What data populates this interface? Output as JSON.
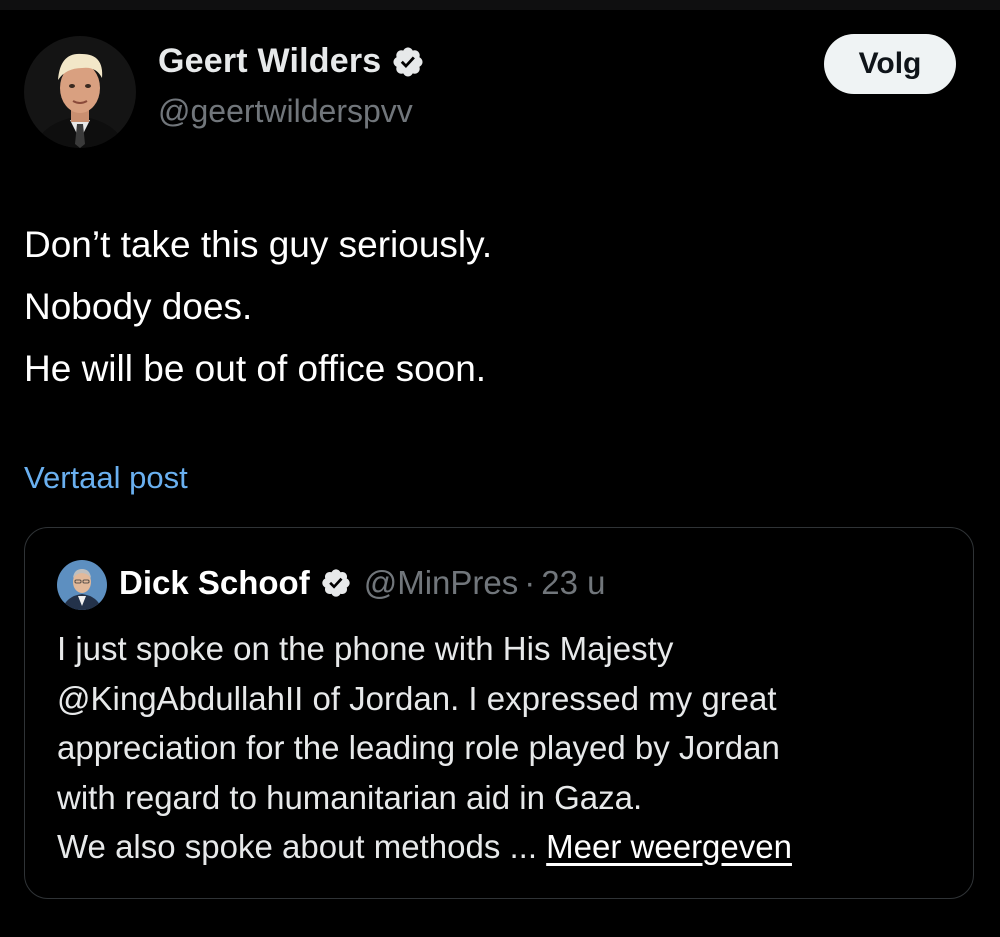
{
  "post": {
    "author": {
      "name": "Geert Wilders",
      "handle": "@geertwilderspvv",
      "verified_icon": "verified-badge-icon"
    },
    "follow_label": "Volg",
    "text_lines": [
      "Don’t take this guy seriously.",
      "Nobody does.",
      "He will be out of office soon."
    ],
    "translate_label": "Vertaal post"
  },
  "quoted_post": {
    "author": {
      "name": "Dick Schoof",
      "handle": "@MinPres",
      "verified_icon": "verified-badge-icon"
    },
    "separator": "·",
    "time": "23 u",
    "text_lines": [
      "I just spoke on the phone with His Majesty",
      "@KingAbdullahII of Jordan. I expressed my great",
      "appreciation for the leading role played by Jordan",
      "with regard to humanitarian aid in Gaza."
    ],
    "last_line": "We also spoke about methods ...",
    "show_more_label": "Meer weergeven"
  },
  "colors": {
    "background": "#000000",
    "text_primary": "#e7e9ea",
    "text_secondary": "#71767b",
    "link": "#6ab0f0",
    "border": "#2f3336",
    "follow_button_bg": "#eff3f4"
  }
}
